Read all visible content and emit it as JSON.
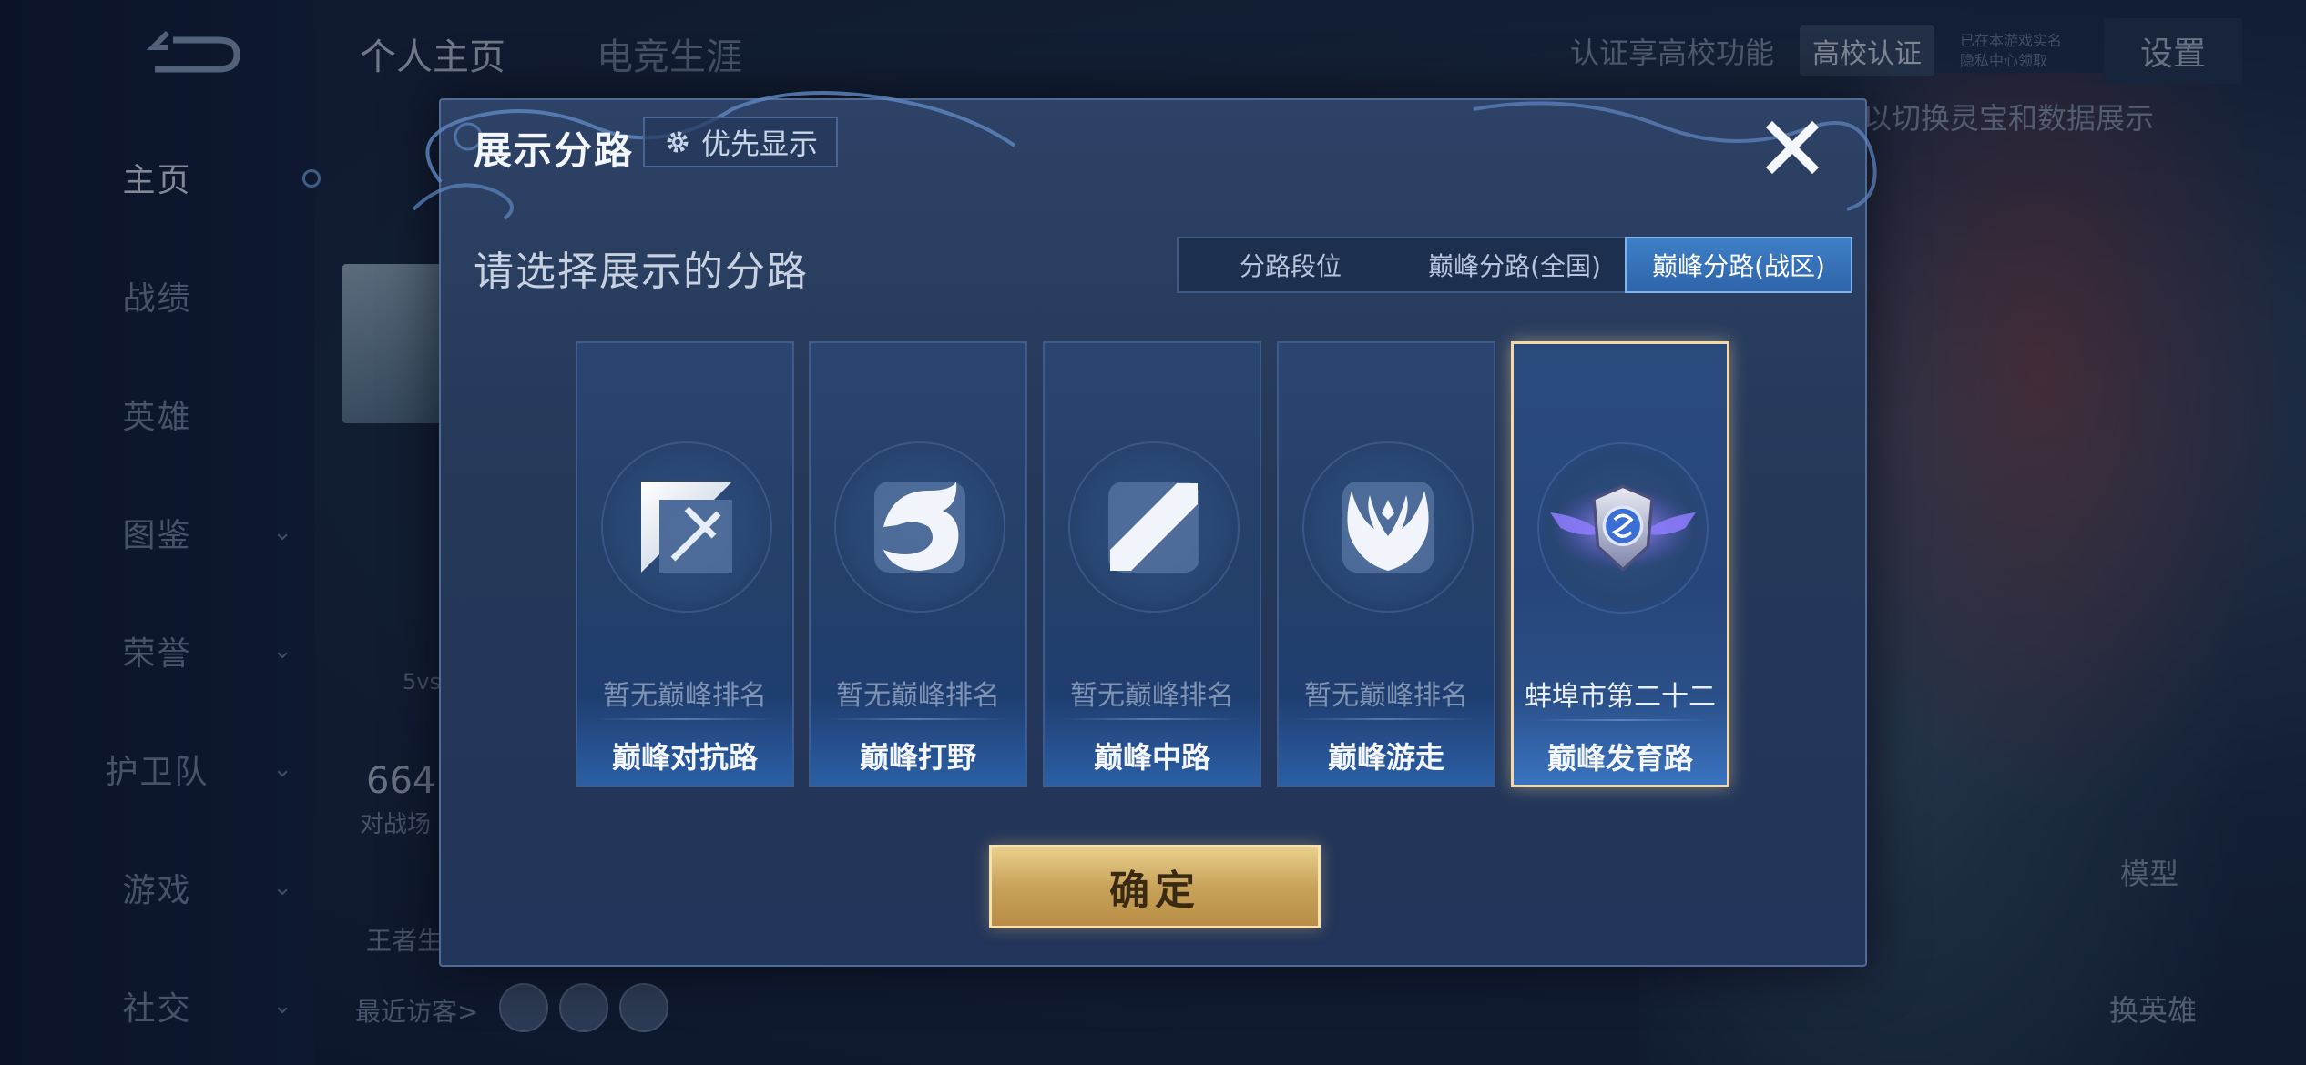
{
  "background": {
    "top_tabs": [
      "个人主页",
      "电竞生涯"
    ],
    "sidebar": [
      {
        "label": "主页",
        "active": true,
        "has_chevron": false
      },
      {
        "label": "战绩",
        "active": false,
        "has_chevron": false
      },
      {
        "label": "英雄",
        "active": false,
        "has_chevron": false
      },
      {
        "label": "图鉴",
        "active": false,
        "has_chevron": true
      },
      {
        "label": "荣誉",
        "active": false,
        "has_chevron": true
      },
      {
        "label": "护卫队",
        "active": false,
        "has_chevron": true
      },
      {
        "label": "游戏",
        "active": false,
        "has_chevron": true
      },
      {
        "label": "社交",
        "active": false,
        "has_chevron": true
      }
    ],
    "cert_text": "认证享高校功能",
    "cert_button": "高校认证",
    "verified_note_1": "已在本游戏实名",
    "verified_note_2": "隐私中心领取",
    "settings": "设置",
    "switch_hint": "以切换灵宝和数据展示",
    "mode": "5vs",
    "stat_num": "664",
    "stat_label": "对战场",
    "king_label": "王者生",
    "recent_visitors": "最近访客>",
    "model_label": "模型",
    "change_hero_label": "换英雄"
  },
  "dialog": {
    "title": "展示分路",
    "priority_button": "优先显示",
    "subtitle": "请选择展示的分路",
    "segments": [
      {
        "label": "分路段位",
        "selected": false
      },
      {
        "label": "巅峰分路(全国)",
        "selected": false
      },
      {
        "label": "巅峰分路(战区)",
        "selected": true
      }
    ],
    "cards": [
      {
        "rank": "暂无巅峰排名",
        "lane": "巅峰对抗路",
        "icon": "clash-lane-icon",
        "selected": false
      },
      {
        "rank": "暂无巅峰排名",
        "lane": "巅峰打野",
        "icon": "jungle-dragon-icon",
        "selected": false
      },
      {
        "rank": "暂无巅峰排名",
        "lane": "巅峰中路",
        "icon": "mid-lane-icon",
        "selected": false
      },
      {
        "rank": "暂无巅峰排名",
        "lane": "巅峰游走",
        "icon": "roam-wings-icon",
        "selected": false
      },
      {
        "rank": "蚌埠市第二十二",
        "lane": "巅峰发育路",
        "icon": "winged-shield-badge-icon",
        "selected": true
      }
    ],
    "confirm": "确定"
  },
  "colors": {
    "dialog_bg": "#253858",
    "accent_blue": "#3e7fc8",
    "selected_border": "#f3d9a6",
    "confirm_gold": "#c9a35a"
  }
}
